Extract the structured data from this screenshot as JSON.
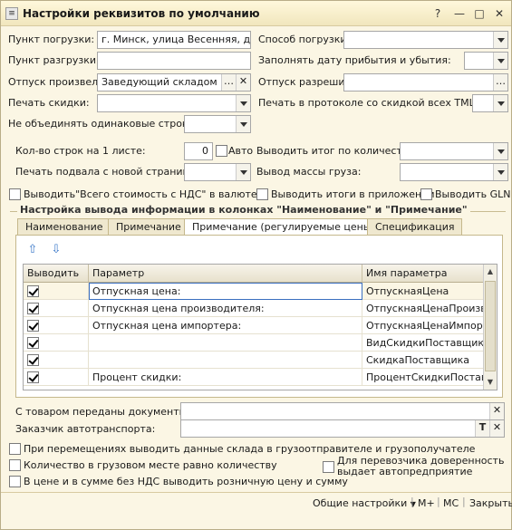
{
  "window": {
    "title": "Настройки реквизитов по умолчанию",
    "icon_glyph": "≡",
    "help": "?",
    "minimize": "—",
    "maximize": "□",
    "close": "✕"
  },
  "form": {
    "load_point_label": "Пункт погрузки:",
    "load_point_value": "г. Минск, улица Весенняя, дом №",
    "unload_point_label": "Пункт разгрузки:",
    "unload_point_value": "",
    "shipped_by_label": "Отпуск произвел:",
    "shipped_by_value": "Заведующий складом Кос",
    "print_discount_label": "Печать скидки:",
    "print_discount_value": "",
    "no_merge_rows_label": "Не объединять одинаковые строки:",
    "no_merge_rows_value": "",
    "load_method_label": "Способ погрузки:",
    "load_method_value": "",
    "fill_dates_label": "Заполнять дату прибытия и убытия:",
    "fill_dates_value": "",
    "allowed_by_label": "Отпуск разрешил:",
    "allowed_by_value": "",
    "print_protocol_label": "Печать в протоколе со скидкой всех ТМЦ:",
    "print_protocol_value": "",
    "rows_per_sheet_label": "Кол-во строк на 1 листе:",
    "rows_per_sheet_value": "0",
    "auto_label": "Авто",
    "footer_new_page_label": "Печать подвала с новой страницы:",
    "footer_new_page_value": "",
    "total_by_qty_label": "Выводить итог по количеству:",
    "total_by_qty_value": "",
    "cargo_mass_label": "Вывод массы груза:",
    "cargo_mass_value": "",
    "total_vat_currency_label": "Выводить\"Всего стоимость с НДС\" в валюте",
    "totals_in_appendix_label": "Выводить итоги в приложении",
    "gln_label": "Выводить GLN"
  },
  "section": {
    "title": "Настройка вывода информации в колонках \"Наименование\" и \"Примечание\"",
    "tabs": [
      "Наименование",
      "Примечание",
      "Примечание (регулируемые цены)",
      "Спецификация"
    ],
    "active_tab": 2,
    "columns": [
      "Выводить",
      "Параметр",
      "Имя параметра"
    ],
    "rows": [
      {
        "checked": true,
        "param": "Отпускная цена:",
        "name": "ОтпускнаяЦена"
      },
      {
        "checked": true,
        "param": "Отпускная цена производителя:",
        "name": "ОтпускнаяЦенаПроизв..."
      },
      {
        "checked": true,
        "param": "Отпускная цена импортера:",
        "name": "ОтпускнаяЦенаИмпорт..."
      },
      {
        "checked": true,
        "param": "",
        "name": "ВидСкидкиПоставщика"
      },
      {
        "checked": true,
        "param": "",
        "name": "СкидкаПоставщика"
      },
      {
        "checked": true,
        "param": "Процент скидки:",
        "name": "ПроцентСкидкиПостав..."
      }
    ]
  },
  "lower": {
    "docs_with_goods_label": "С товаром переданы документы:",
    "docs_with_goods_value": "",
    "transport_customer_label": "Заказчик автотранспорта:",
    "transport_customer_value": "",
    "clear_glyph": "✕",
    "text_glyph": "T",
    "moves_warehouse_label": "При перемещениях выводить данные склада в грузоотправителе и грузополучателе",
    "qty_per_place_label": "Количество в грузовом месте равно количеству",
    "carrier_proxy_label": "Для перевозчика доверенность выдает автопредприятие",
    "retail_price_label": "В цене и в сумме без НДС выводить розничную цену и сумму"
  },
  "bottom": {
    "general_settings": "Общие настройки",
    "m_plus": "М+",
    "mc": "МС",
    "close": "Закрыть"
  }
}
